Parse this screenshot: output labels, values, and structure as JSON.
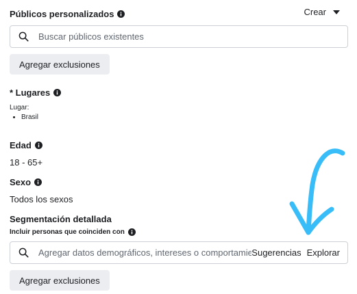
{
  "custom_audiences": {
    "title": "Públicos personalizados",
    "create_label": "Crear",
    "search_placeholder": "Buscar públicos existentes",
    "exclude_button": "Agregar exclusiones"
  },
  "locations": {
    "title": "* Lugares",
    "sublabel": "Lugar:",
    "items": [
      "Brasil"
    ]
  },
  "age": {
    "title": "Edad",
    "value": "18 - 65+"
  },
  "gender": {
    "title": "Sexo",
    "value": "Todos los sexos"
  },
  "detailed_targeting": {
    "title": "Segmentación detallada",
    "subtitle": "Incluir personas que coinciden con",
    "search_placeholder": "Agregar datos demográficos, intereses o comportamientos",
    "suggestions_label": "Sugerencias",
    "explore_label": "Explorar",
    "exclude_button": "Agregar exclusiones"
  },
  "colors": {
    "text": "#1c1e21",
    "button_bg": "#ebedf0",
    "border": "#ccd0d5",
    "annotation_arrow": "#38bdf8"
  },
  "icons": {
    "info": "info-icon",
    "search": "search-icon",
    "dropdown": "caret-down-icon",
    "annotation": "arrow-annotation"
  }
}
